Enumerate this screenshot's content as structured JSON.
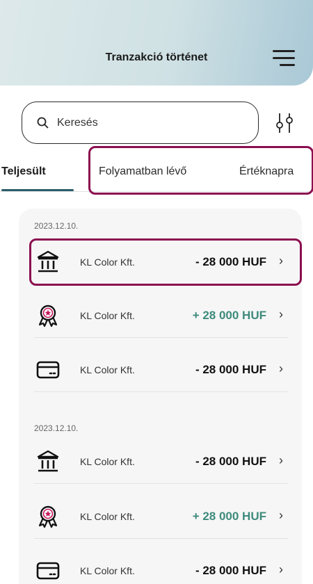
{
  "header": {
    "title": "Tranzakció történet",
    "menu_icon": "hamburger-menu-icon"
  },
  "search": {
    "placeholder": "Keresés",
    "value": "",
    "icon": "search-icon"
  },
  "filter": {
    "icon": "filter-sliders-icon"
  },
  "tabs": [
    {
      "label": "Teljesült",
      "active": true
    },
    {
      "label": "Folyamatban lévő",
      "active": false
    },
    {
      "label": "Értéknapra",
      "active": false
    }
  ],
  "colors": {
    "highlight": "#8b0e4f",
    "positive": "#3e8a7c",
    "tab_underline": "#2a5c6a"
  },
  "groups": [
    {
      "date": "2023.12.10.",
      "items": [
        {
          "icon": "bank-icon",
          "name": "KL Color Kft.",
          "amount": "- 28 000 HUF",
          "positive": false
        },
        {
          "icon": "award-badge-icon",
          "name": "KL Color Kft.",
          "amount": "+ 28 000 HUF",
          "positive": true
        },
        {
          "icon": "card-icon",
          "name": "KL Color Kft.",
          "amount": "- 28 000 HUF",
          "positive": false
        }
      ]
    },
    {
      "date": "2023.12.10.",
      "items": [
        {
          "icon": "bank-icon",
          "name": "KL Color Kft.",
          "amount": "- 28 000 HUF",
          "positive": false
        },
        {
          "icon": "award-badge-icon",
          "name": "KL Color Kft.",
          "amount": "+ 28 000 HUF",
          "positive": true
        },
        {
          "icon": "card-icon",
          "name": "KL Color Kft.",
          "amount": "- 28 000 HUF",
          "positive": false
        }
      ]
    }
  ]
}
